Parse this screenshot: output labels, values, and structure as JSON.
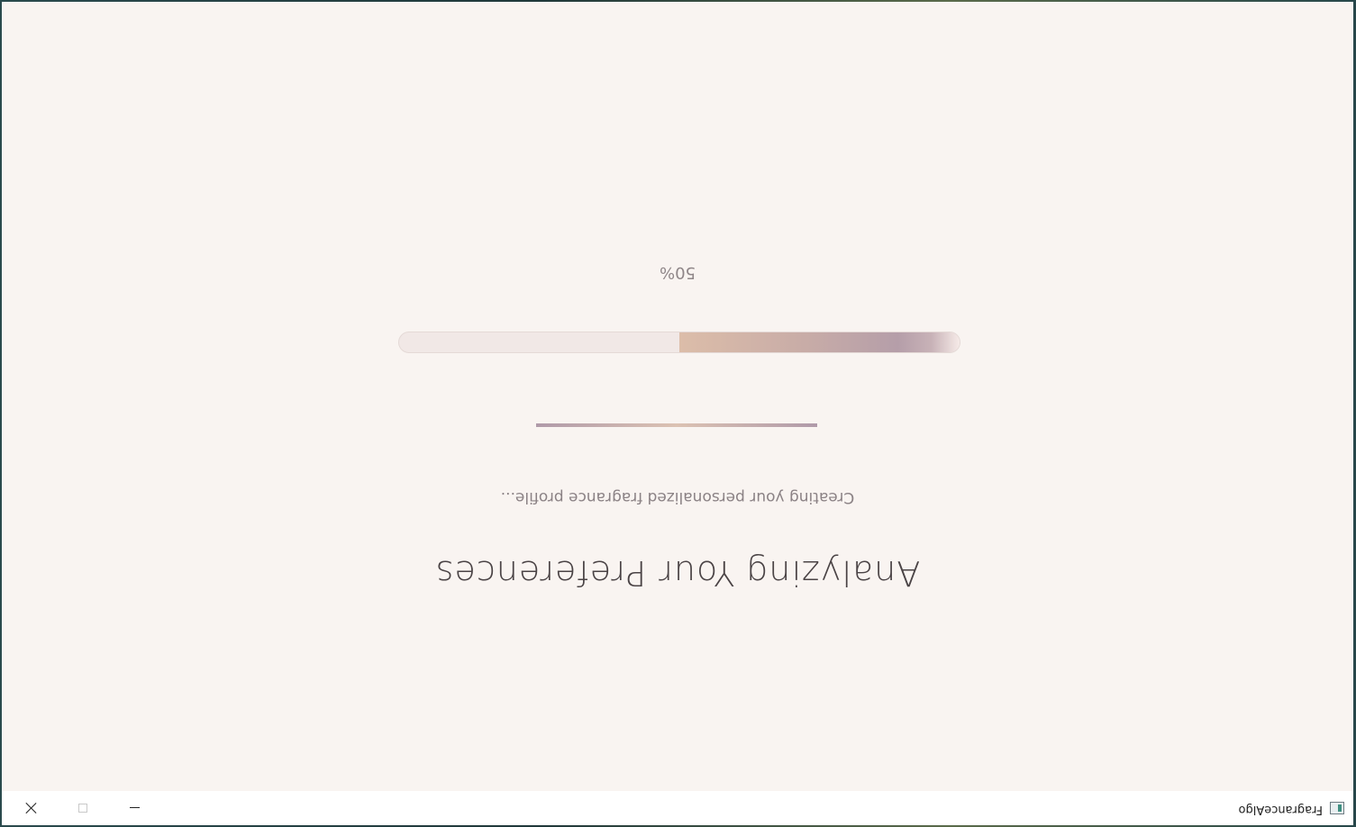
{
  "window": {
    "app_title": "FragranceAlgo",
    "controls": {
      "minimize": "minimize",
      "maximize": "maximize",
      "close": "close"
    }
  },
  "main": {
    "heading": "Analyzing Your Preferences",
    "subheading": "Creating your personalized fragrance profile...",
    "progress": {
      "percent_label": "50%",
      "value": 0.5
    }
  },
  "colors": {
    "background": "#f9f4f1",
    "accent_mauve": "#b09aa9",
    "accent_peach": "#dcc2b3",
    "text_dark": "#4a4345",
    "text_muted": "#8b8285"
  },
  "icons": {
    "app": "app-window-icon",
    "minimize": "minimize-icon",
    "maximize": "maximize-icon",
    "close": "close-icon"
  }
}
